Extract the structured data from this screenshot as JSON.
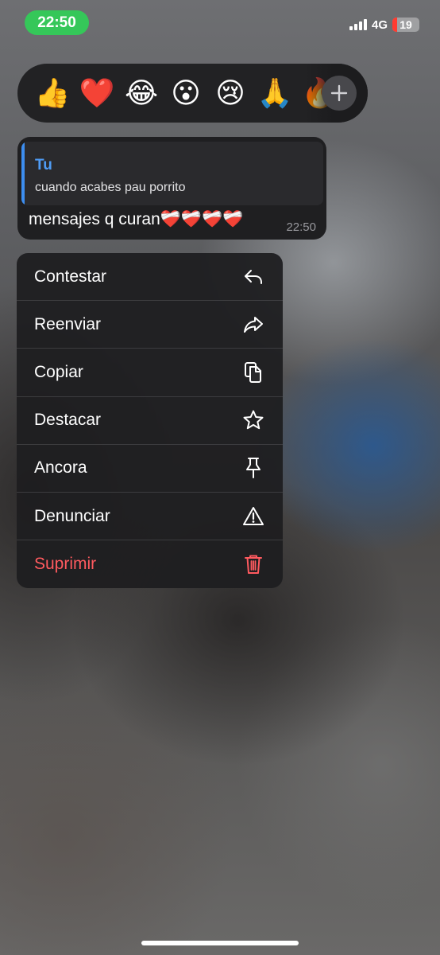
{
  "status_bar": {
    "time": "22:50",
    "network": "4G",
    "battery": "19"
  },
  "reactions": {
    "items": [
      {
        "icon": "thumbs-up-icon",
        "glyph": "👍"
      },
      {
        "icon": "red-heart-icon",
        "glyph": "❤️"
      },
      {
        "icon": "tears-of-joy-icon",
        "glyph": "😂"
      },
      {
        "icon": "surprised-face-icon",
        "glyph": "😮"
      },
      {
        "icon": "crying-face-icon",
        "glyph": "😢"
      },
      {
        "icon": "folded-hands-icon",
        "glyph": "🙏"
      },
      {
        "icon": "fire-icon",
        "glyph": "🔥"
      }
    ],
    "more": "plus-icon"
  },
  "message": {
    "quote_author": "Tu",
    "quote_text": "cuando acabes pau porrito",
    "text": "mensajes q curan❤️‍🩹❤️‍🩹❤️‍🩹❤️‍🩹",
    "time": "22:50"
  },
  "menu": {
    "items": [
      {
        "label": "Contestar",
        "icon": "reply-icon"
      },
      {
        "label": "Reenviar",
        "icon": "forward-icon"
      },
      {
        "label": "Copiar",
        "icon": "copy-icon"
      },
      {
        "label": "Destacar",
        "icon": "star-icon"
      },
      {
        "label": "Ancora",
        "icon": "pin-icon"
      },
      {
        "label": "Denunciar",
        "icon": "warning-icon"
      },
      {
        "label": "Suprimir",
        "icon": "trash-icon",
        "color": "#ff5a5f"
      }
    ]
  },
  "colors": {
    "status_time_bg": "#35c759",
    "quote_accent": "#3d8ef0",
    "danger": "#ff5a5f"
  }
}
